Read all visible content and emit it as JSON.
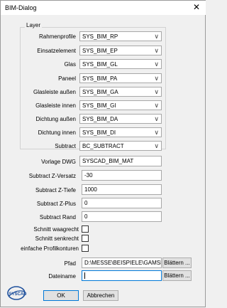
{
  "window": {
    "title": "BIM-Dialog",
    "close_glyph": "✕"
  },
  "layer_group": {
    "legend": "Layer",
    "rows": [
      {
        "label": "Rahmenprofile",
        "value": "SYS_BIM_RP"
      },
      {
        "label": "Einsatzelement",
        "value": "SYS_BIM_EP"
      },
      {
        "label": "Glas",
        "value": "SYS_BIM_GL"
      },
      {
        "label": "Paneel",
        "value": "SYS_BIM_PA"
      },
      {
        "label": "Glasleiste außen",
        "value": "SYS_BIM_GA"
      },
      {
        "label": "Glasleiste innen",
        "value": "SYS_BIM_GI"
      },
      {
        "label": "Dichtung außen",
        "value": "SYS_BIM_DA"
      },
      {
        "label": "Dichtung innen",
        "value": "SYS_BIM_DI"
      },
      {
        "label": "Subtract",
        "value": "BC_SUBTRACT"
      }
    ]
  },
  "fields": {
    "vorlage_label": "Vorlage DWG",
    "vorlage_value": "SYSCAD_BIM_MAT",
    "z_versatz_label": "Subtract Z-Versatz",
    "z_versatz_value": "-30",
    "z_tiefe_label": "Subtract Z-Tiefe",
    "z_tiefe_value": "1000",
    "z_plus_label": "Subtract Z-Plus",
    "z_plus_value": "0",
    "rand_label": "Subtract Rand",
    "rand_value": "0"
  },
  "checkboxes": {
    "waagrecht_label": "Schnitt waagrecht",
    "senkrecht_label": "Schnitt senkrecht",
    "einfach_label": "einfache Profilkonturen"
  },
  "path": {
    "pfad_label": "Pfad",
    "pfad_value": "D:\\MESSE\\BEISPIELE\\GAMSMILC",
    "dateiname_label": "Dateiname",
    "dateiname_value": "",
    "browse_label": "Blättern ..."
  },
  "buttons": {
    "ok": "OK",
    "cancel": "Abbrechen"
  },
  "logo": {
    "text": "SYSCAD",
    "color": "#1d4f9c"
  },
  "colors": {
    "focus": "#0078d7",
    "dropdown_arrow": "∨"
  }
}
